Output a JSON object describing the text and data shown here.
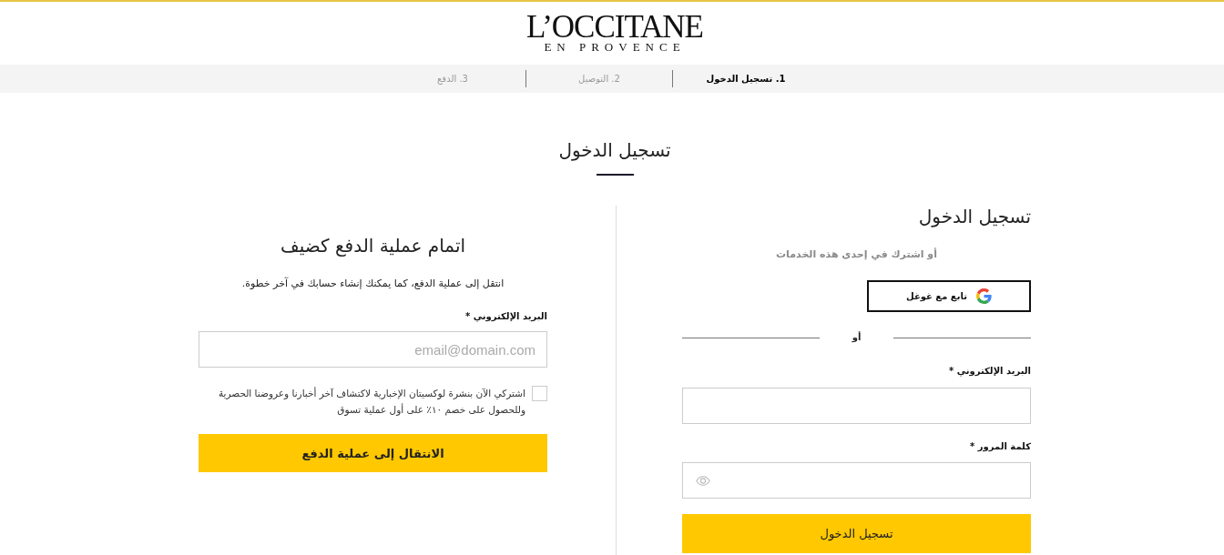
{
  "header": {
    "logo": {
      "wordmark": "L’OCCITANE",
      "tagline": "EN PROVENCE"
    }
  },
  "steps": [
    {
      "label": "1. تسجيل الدخول",
      "selected": true
    },
    {
      "label": "2. التوصيل",
      "selected": false
    },
    {
      "label": "3. الدفع",
      "selected": false
    }
  ],
  "page_title": "تسجيل الدخول",
  "login": {
    "title": "تسجيل الدخول",
    "social_prompt": "أو اشترك في إحدى هذه الخدمات",
    "google_button": "تابع مع غوغل",
    "divider": "أو",
    "fields": [
      {
        "kind": "email",
        "label": "البريد الإلكتروني *"
      },
      {
        "kind": "password",
        "label": "كلمة المرور *"
      }
    ],
    "submit": "تسجيل الدخول"
  },
  "guest": {
    "title": "اتمام عملية الدفع كضيف",
    "intro": "انتقل إلى عملية الدفع، كما يمكنك إنشاء حسابك في آخر خطوة.",
    "email": {
      "label": "البريد الإلكتروني *",
      "placeholder": "email@domain.com"
    },
    "newsletter": {
      "checked": false,
      "label": "اشتركي الآن بنشرة لوكسيتان الإخبارية لاكتشاف آخر أخبارنا وعروضنا الحصرية وللحصول على خصم ١٠٪ على أول عملية تسوق"
    },
    "submit": "الانتقال إلى عملية الدفع"
  }
}
